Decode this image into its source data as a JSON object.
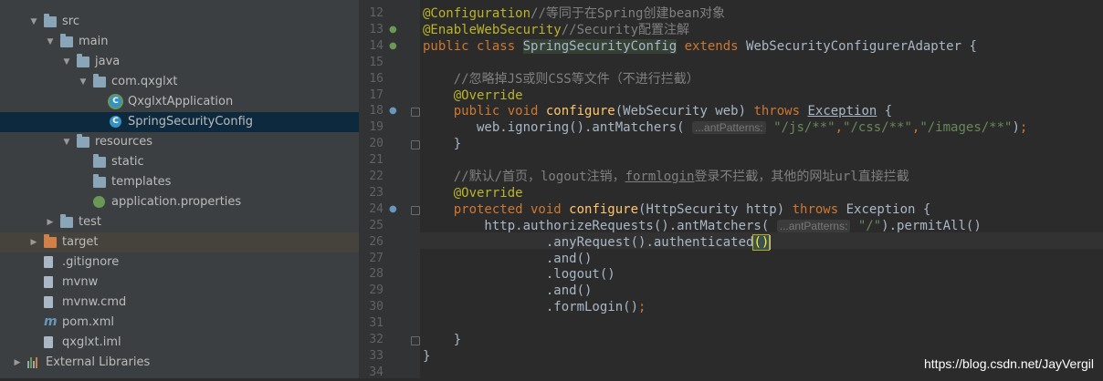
{
  "project_tree": {
    "items": [
      {
        "label": "src",
        "kind": "folder",
        "indent": 1,
        "arrow": "▼"
      },
      {
        "label": "main",
        "kind": "folder",
        "indent": 2,
        "arrow": "▼"
      },
      {
        "label": "java",
        "kind": "folder-blue",
        "indent": 3,
        "arrow": "▼"
      },
      {
        "label": "com.qxglxt",
        "kind": "package",
        "indent": 4,
        "arrow": "▼"
      },
      {
        "label": "QxglxtApplication",
        "kind": "spring-class",
        "indent": 5,
        "arrow": ""
      },
      {
        "label": "SpringSecurityConfig",
        "kind": "class",
        "indent": 5,
        "arrow": "",
        "selected": true
      },
      {
        "label": "resources",
        "kind": "resources",
        "indent": 3,
        "arrow": "▼"
      },
      {
        "label": "static",
        "kind": "folder",
        "indent": 4,
        "arrow": ""
      },
      {
        "label": "templates",
        "kind": "folder",
        "indent": 4,
        "arrow": ""
      },
      {
        "label": "application.properties",
        "kind": "spring-file",
        "indent": 4,
        "arrow": ""
      },
      {
        "label": "test",
        "kind": "folder",
        "indent": 2,
        "arrow": "▶"
      },
      {
        "label": "target",
        "kind": "folder-orange",
        "indent": 1,
        "arrow": "▶",
        "highlighted": true
      },
      {
        "label": ".gitignore",
        "kind": "file",
        "indent": 1,
        "arrow": ""
      },
      {
        "label": "mvnw",
        "kind": "file",
        "indent": 1,
        "arrow": ""
      },
      {
        "label": "mvnw.cmd",
        "kind": "file",
        "indent": 1,
        "arrow": ""
      },
      {
        "label": "pom.xml",
        "kind": "maven",
        "indent": 1,
        "arrow": ""
      },
      {
        "label": "qxglxt.iml",
        "kind": "file",
        "indent": 1,
        "arrow": ""
      },
      {
        "label": "External Libraries",
        "kind": "libraries",
        "indent": 0,
        "arrow": "▶"
      }
    ]
  },
  "editor": {
    "line_numbers": [
      "12",
      "13",
      "14",
      "15",
      "16",
      "17",
      "18",
      "19",
      "20",
      "21",
      "22",
      "23",
      "24",
      "25",
      "26",
      "27",
      "28",
      "29",
      "30",
      "31",
      "32",
      "33",
      "34"
    ],
    "lines": [
      {
        "t": [
          {
            "c": "an",
            "v": "@Configuration"
          },
          {
            "c": "cm",
            "v": "//等同于在Spring创建bean对象"
          }
        ]
      },
      {
        "t": [
          {
            "c": "an",
            "v": "@EnableWebSecurity"
          },
          {
            "c": "cm",
            "v": "//Security配置注解"
          }
        ]
      },
      {
        "t": [
          {
            "c": "kw",
            "v": "public class "
          },
          {
            "c": "hlcls",
            "v": "SpringSecurityConfig"
          },
          {
            "c": "kw",
            "v": " extends "
          },
          {
            "c": "",
            "v": "WebSecurityConfigurerAdapter {"
          }
        ]
      },
      {
        "t": []
      },
      {
        "t": [
          {
            "c": "",
            "v": "    "
          },
          {
            "c": "cm",
            "v": "//忽略掉JS或则CSS等文件（不进行拦截）"
          }
        ]
      },
      {
        "t": [
          {
            "c": "",
            "v": "    "
          },
          {
            "c": "an",
            "v": "@Override"
          }
        ]
      },
      {
        "t": [
          {
            "c": "",
            "v": "    "
          },
          {
            "c": "kw",
            "v": "public void "
          },
          {
            "c": "fn",
            "v": "configure"
          },
          {
            "c": "",
            "v": "(WebSecurity web) "
          },
          {
            "c": "kw",
            "v": "throws "
          },
          {
            "c": "und",
            "v": "Exception"
          },
          {
            "c": "",
            "v": " {"
          }
        ]
      },
      {
        "t": [
          {
            "c": "",
            "v": "       web.ignoring().antMatchers( "
          },
          {
            "c": "hint",
            "v": "...antPatterns:"
          },
          {
            "c": "st",
            "v": " \"/js/**\""
          },
          {
            "c": "kw",
            "v": ","
          },
          {
            "c": "st",
            "v": "\"/css/**\""
          },
          {
            "c": "kw",
            "v": ","
          },
          {
            "c": "st",
            "v": "\"/images/**\""
          },
          {
            "c": "",
            "v": ")"
          },
          {
            "c": "kw",
            "v": ";"
          }
        ]
      },
      {
        "t": [
          {
            "c": "",
            "v": "    }"
          }
        ]
      },
      {
        "t": []
      },
      {
        "t": [
          {
            "c": "",
            "v": "    "
          },
          {
            "c": "cm",
            "v": "//默认/首页，logout注销，"
          },
          {
            "c": "cm und",
            "v": "formlogin"
          },
          {
            "c": "cm",
            "v": "登录不拦截，其他的网址url直接拦截"
          }
        ]
      },
      {
        "t": [
          {
            "c": "",
            "v": "    "
          },
          {
            "c": "an",
            "v": "@Override"
          }
        ]
      },
      {
        "t": [
          {
            "c": "",
            "v": "    "
          },
          {
            "c": "kw",
            "v": "protected void "
          },
          {
            "c": "fn",
            "v": "configure"
          },
          {
            "c": "",
            "v": "(HttpSecurity http) "
          },
          {
            "c": "kw",
            "v": "throws "
          },
          {
            "c": "",
            "v": "Exception {"
          }
        ]
      },
      {
        "t": [
          {
            "c": "",
            "v": "        http.authorizeRequests().antMatchers( "
          },
          {
            "c": "hint",
            "v": "...antPatterns:"
          },
          {
            "c": "st",
            "v": " \"/\""
          },
          {
            "c": "",
            "v": ").permitAll()"
          }
        ]
      },
      {
        "t": [
          {
            "c": "",
            "v": "                ."
          },
          {
            "c": "",
            "v": "anyRequest().authenticated"
          },
          {
            "c": "brk",
            "v": "()"
          },
          {
            "c": "caret",
            "v": ""
          }
        ]
      },
      {
        "t": [
          {
            "c": "",
            "v": "                .and()"
          }
        ]
      },
      {
        "t": [
          {
            "c": "",
            "v": "                .logout()"
          }
        ]
      },
      {
        "t": [
          {
            "c": "",
            "v": "                .and()"
          }
        ]
      },
      {
        "t": [
          {
            "c": "",
            "v": "                .formLogin()"
          },
          {
            "c": "kw",
            "v": ";"
          }
        ]
      },
      {
        "t": []
      },
      {
        "t": [
          {
            "c": "",
            "v": "    }"
          }
        ]
      },
      {
        "t": [
          {
            "c": "",
            "v": "}"
          }
        ]
      },
      {
        "t": []
      }
    ]
  },
  "watermark": "https://blog.csdn.net/JayVergil",
  "colors": {
    "keyword": "#cc7832",
    "annotation": "#bbb529",
    "comment": "#808080",
    "string": "#6a8759",
    "method": "#ffc66d",
    "text": "#a9b7c6"
  }
}
